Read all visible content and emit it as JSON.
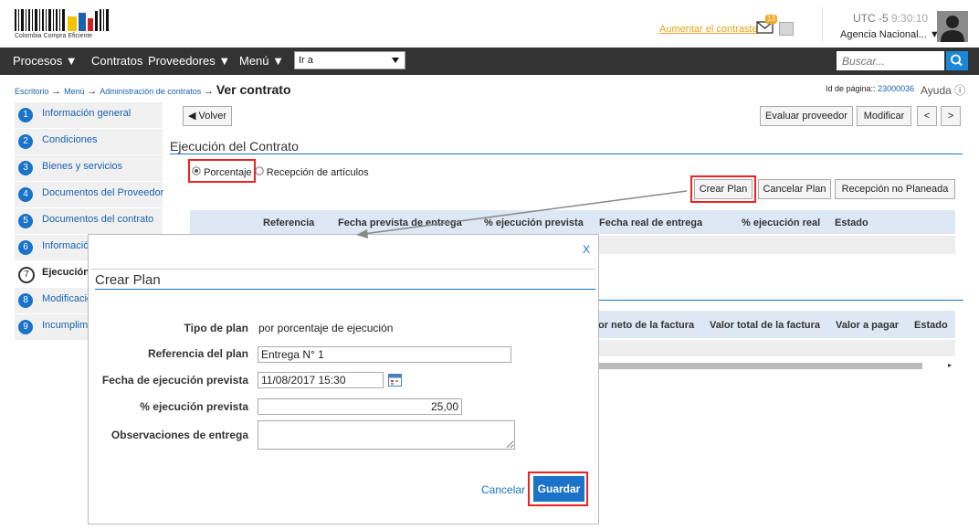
{
  "header": {
    "logo_caption": "Colombia Compra Eficiente",
    "contrast_link": "Aumentar el contraste",
    "mail_count": "13",
    "utc_label": "UTC -5",
    "utc_time": "9:30:10",
    "agency": "Agencia Nacional..."
  },
  "nav": {
    "procesos": "Procesos ▼",
    "contratos": "Contratos",
    "proveedores": "Proveedores ▼",
    "menu": "Menú ▼",
    "goto": "Ir a",
    "search_placeholder": "Buscar..."
  },
  "breadcrumb": {
    "escritorio": "Escritorio",
    "menu": "Menú",
    "admin": "Administración de contratos",
    "current": "Ver contrato",
    "page_id_label": "Id de página::",
    "page_id": "23000036",
    "help": "Ayuda ⓘ"
  },
  "steps": [
    {
      "num": "1",
      "label": "Información general"
    },
    {
      "num": "2",
      "label": "Condiciones"
    },
    {
      "num": "3",
      "label": "Bienes y servicios"
    },
    {
      "num": "4",
      "label": "Documentos del Proveedor"
    },
    {
      "num": "5",
      "label": "Documentos del contrato"
    },
    {
      "num": "6",
      "label": "Informació"
    },
    {
      "num": "7",
      "label": "Ejecución"
    },
    {
      "num": "8",
      "label": "Modificació"
    },
    {
      "num": "9",
      "label": "Incumplimi"
    }
  ],
  "toolbar": {
    "volver": "Volver",
    "evaluar": "Evaluar proveedor",
    "modificar": "Modificar",
    "prev": "<",
    "next": ">"
  },
  "execution": {
    "title": "Ejecución del Contrato",
    "radio1": "Porcentaje",
    "radio2": "Recepción de artículos",
    "crear_plan": "Crear Plan",
    "cancelar_plan": "Cancelar Plan",
    "recepcion": "Recepción no Planeada",
    "columns": [
      "Referencia",
      "Fecha prevista de entrega",
      "% ejecución prevista",
      "Fecha real de entrega",
      "% ejecución real",
      "Estado"
    ]
  },
  "invoice": {
    "columns": [
      "or neto de la factura",
      "Valor total de la factura",
      "Valor a pagar",
      "Estado"
    ]
  },
  "modal": {
    "close": "X",
    "title": "Crear Plan",
    "tipo_label": "Tipo de plan",
    "tipo_value": "por porcentaje de ejecución",
    "ref_label": "Referencia del plan",
    "ref_value": "Entrega N° 1",
    "fecha_label": "Fecha de ejecución prevista",
    "fecha_value": "11/08/2017 15:30",
    "pct_label": "% ejecución prevista",
    "pct_value": "25,00",
    "obs_label": "Observaciones de entrega",
    "cancel": "Cancelar",
    "save": "Guardar"
  },
  "colors": {
    "accent": "#1a73c8",
    "highlight": "#ee2222",
    "nav_bg": "#333333"
  }
}
